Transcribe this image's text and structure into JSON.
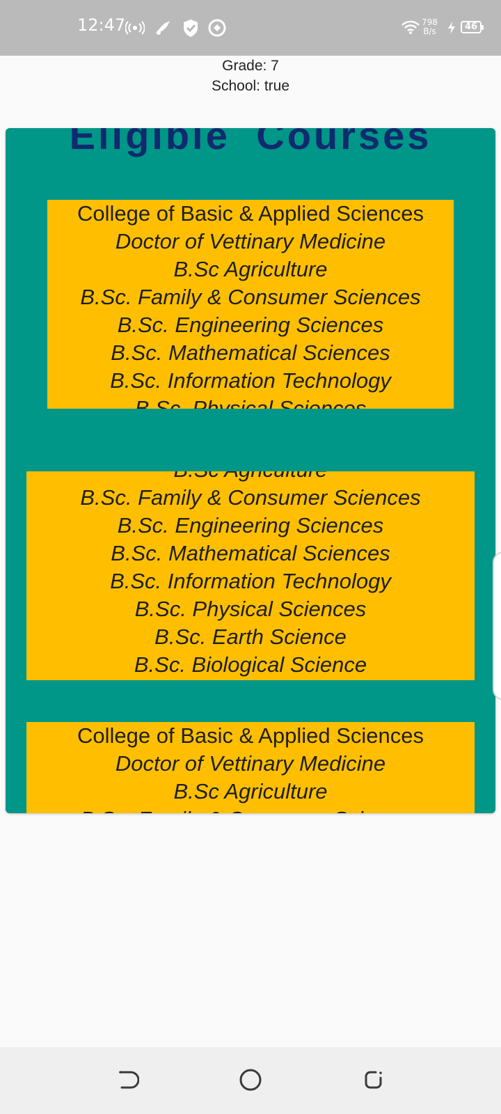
{
  "status_bar": {
    "time": "12:47",
    "net_speed_value": "798",
    "net_speed_unit": "B/s",
    "battery": "46",
    "icons": [
      "hotspot-icon",
      "rocket-icon",
      "shield-check-icon",
      "sync-icon",
      "wifi-icon",
      "charging-icon",
      "battery-icon"
    ]
  },
  "info": {
    "grade": "Grade: 7",
    "school": "School: true"
  },
  "panel": {
    "title": "Eligible  Courses",
    "background": "#009688",
    "card_color": "#ffbf00",
    "title_color": "#102a6e"
  },
  "cards": [
    {
      "college": "College of Basic & Applied Sciences",
      "programs": [
        "Doctor of Vettinary Medicine",
        "B.Sc Agriculture",
        "B.Sc. Family & Consumer Sciences",
        "B.Sc. Engineering Sciences",
        "B.Sc. Mathematical Sciences",
        "B.Sc. Information Technology",
        "B.Sc. Physical Sciences"
      ]
    },
    {
      "programs": [
        "B.Sc Agriculture",
        "B.Sc. Family & Consumer Sciences",
        "B.Sc. Engineering Sciences",
        "B.Sc. Mathematical Sciences",
        "B.Sc. Information Technology",
        "B.Sc. Physical Sciences",
        "B.Sc. Earth Science",
        "B.Sc. Biological Science"
      ]
    },
    {
      "college": "College of Basic & Applied Sciences",
      "programs": [
        "Doctor of Vettinary Medicine",
        "B.Sc Agriculture",
        "B.Sc. Family & Consumer Sciences"
      ]
    }
  ],
  "nav": [
    "back-icon",
    "home-icon",
    "recents-icon"
  ]
}
